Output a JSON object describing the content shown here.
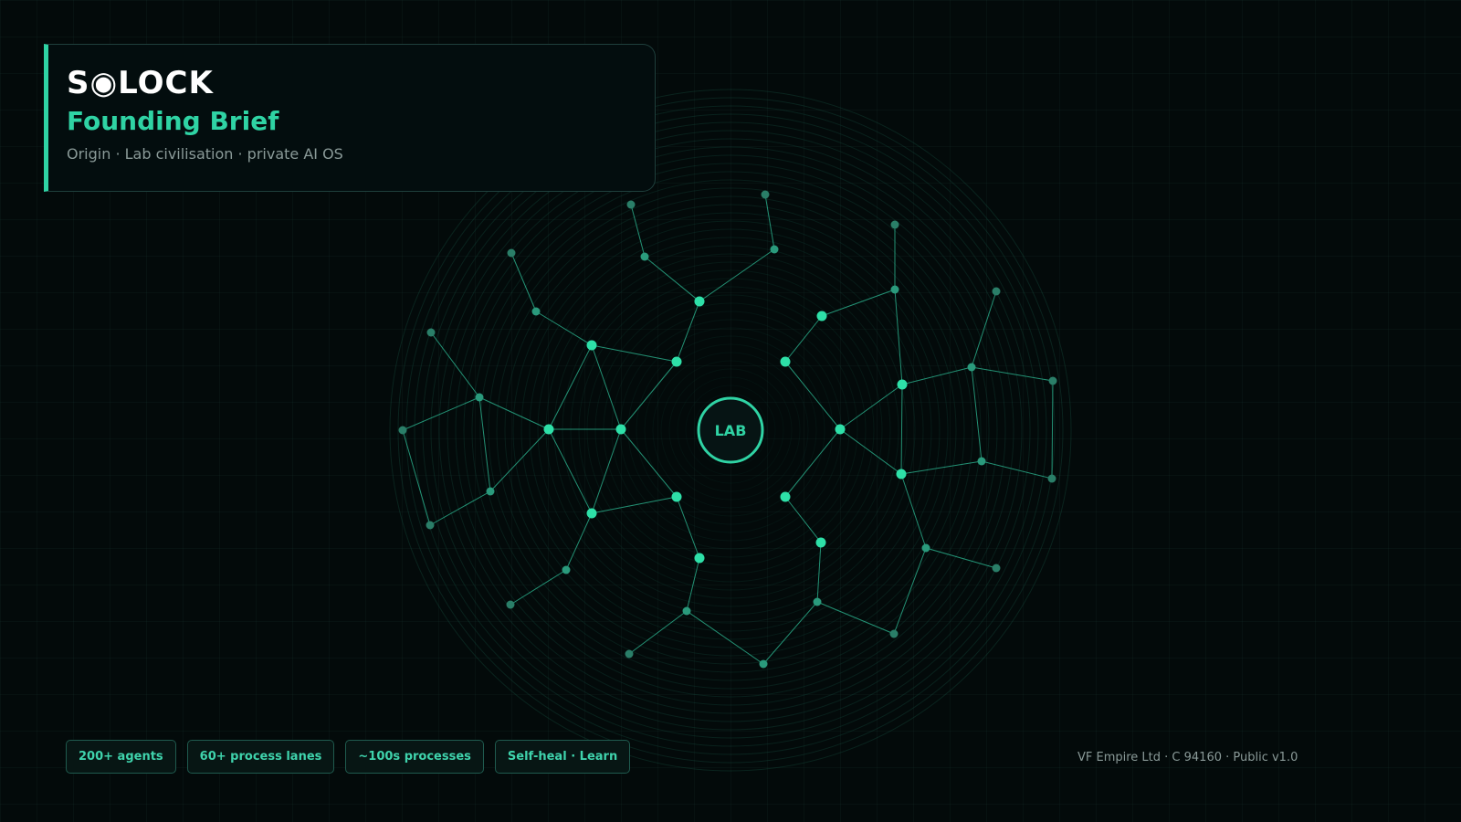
{
  "header": {
    "brand": "S◉LOCK",
    "title": "Founding Brief",
    "subtitle": "Origin · Lab civilisation · private AI OS"
  },
  "diagram": {
    "center_label": "LAB",
    "accent_color": "#2fd3a4",
    "node_color": "#2ee0a8",
    "outer_node_color": "#2a7e68",
    "line_color": "#2fbf98"
  },
  "badges": [
    {
      "label": "200+ agents"
    },
    {
      "label": "60+ process lanes"
    },
    {
      "label": "~100s processes"
    },
    {
      "label": "Self-heal · Learn"
    }
  ],
  "footer": {
    "credit": "VF Empire Ltd · C 94160 · Public v1.0"
  },
  "colors": {
    "background": "#030a0a",
    "accent": "#2fd3a4",
    "muted_text": "#8a9a98"
  }
}
